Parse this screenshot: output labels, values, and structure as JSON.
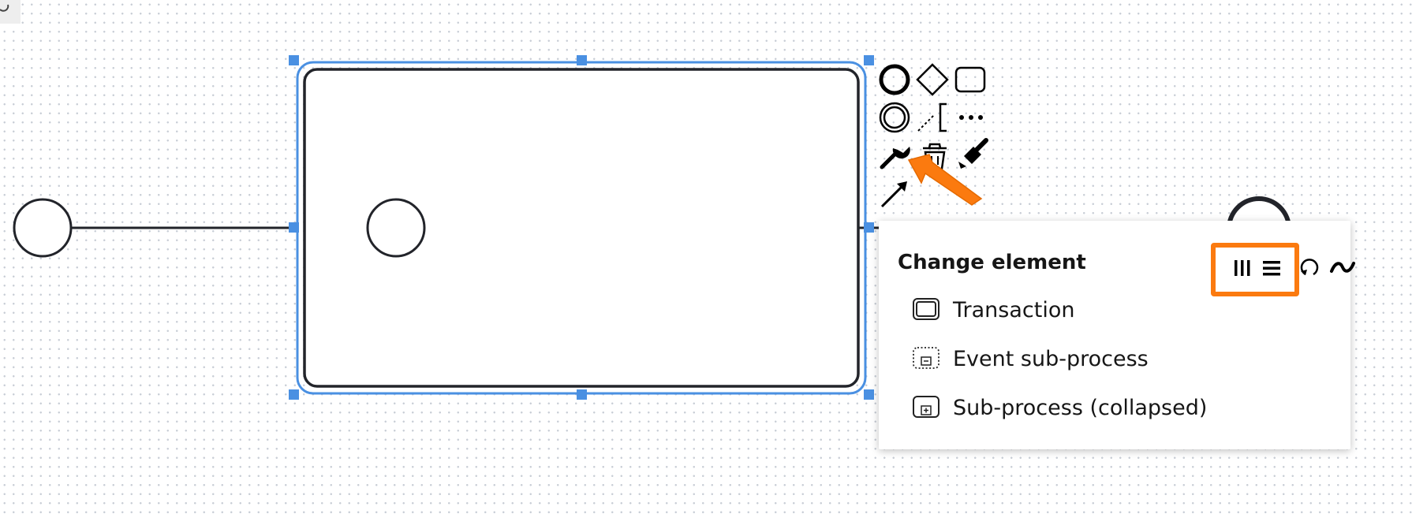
{
  "diagram": {
    "selection_color": "#4a90e2",
    "stroke_color": "#22242a"
  },
  "context_pad": {
    "highlight_color": "#fb7a0f",
    "items": [
      {
        "icon": "end-event-icon"
      },
      {
        "icon": "gateway-icon"
      },
      {
        "icon": "task-icon"
      },
      {
        "icon": "intermediate-event-icon"
      },
      {
        "icon": "text-annotation-icon"
      },
      {
        "icon": "more-icon"
      },
      {
        "icon": "wrench-icon"
      },
      {
        "icon": "trash-icon"
      },
      {
        "icon": "paint-brush-icon"
      },
      {
        "icon": "connect-arrow-icon"
      }
    ]
  },
  "popup": {
    "title": "Change element",
    "header_buttons": [
      {
        "icon": "parallel-multi-instance-icon"
      },
      {
        "icon": "sequential-multi-instance-icon"
      },
      {
        "icon": "loop-icon"
      },
      {
        "icon": "ad-hoc-icon"
      }
    ],
    "entries": [
      {
        "label": "Transaction",
        "icon": "transaction-icon"
      },
      {
        "label": "Event sub-process",
        "icon": "event-subprocess-icon"
      },
      {
        "label": "Sub-process (collapsed)",
        "icon": "collapsed-subprocess-icon"
      }
    ]
  }
}
